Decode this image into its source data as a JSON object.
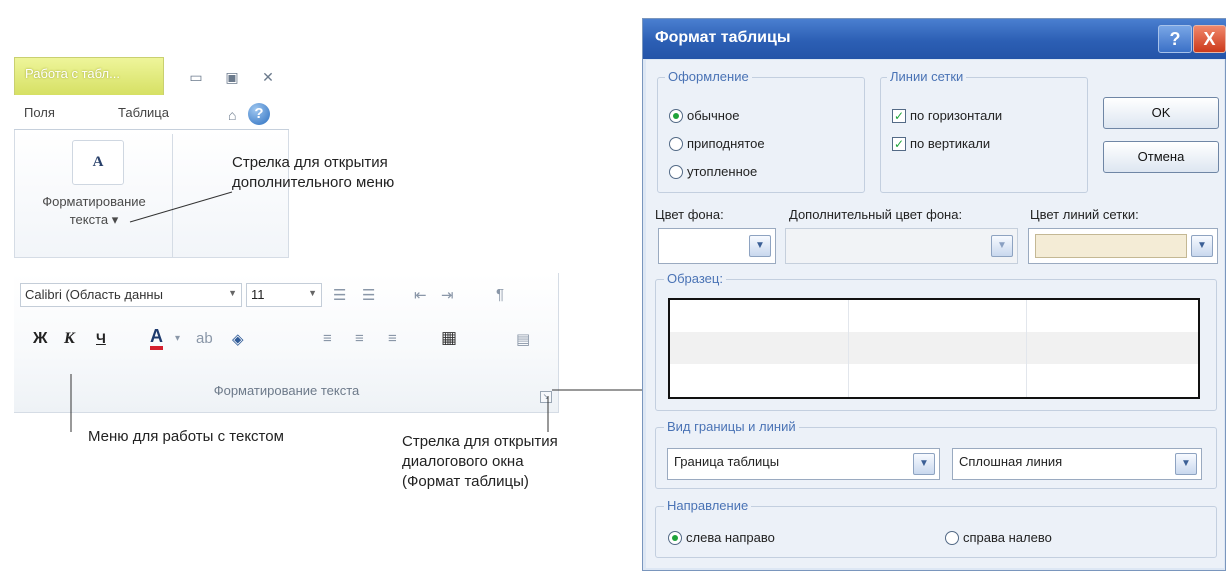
{
  "ribbon": {
    "context_tab": "Работа с табл...",
    "tabs": [
      "Поля",
      "Таблица"
    ],
    "window_buttons": [
      "▭",
      "▣",
      "✕"
    ],
    "help_glyph": "?",
    "big_button_glyph": "A",
    "big_button_label_line1": "Форматирование",
    "big_button_label_line2": "текста ▾"
  },
  "toolbar": {
    "font_name": "Calibri (Область данны",
    "font_size": "11",
    "bold": "Ж",
    "italic": "К",
    "underline": "Ч",
    "font_color_glyph": "A",
    "group_caption": "Форматирование текста"
  },
  "annotations": {
    "arrow_menu_line1": "Стрелка для открытия",
    "arrow_menu_line2": "дополнительного меню",
    "text_menu": "Меню для работы с текстом",
    "dialog_arrow_line1": "Стрелка для открытия",
    "dialog_arrow_line2": "диалогового окна",
    "dialog_arrow_line3": "(Формат таблицы)"
  },
  "dialog": {
    "title": "Формат таблицы",
    "help": "?",
    "close": "X",
    "style_group": {
      "legend": "Оформление",
      "options": [
        "обычное",
        "приподнятое",
        "утопленное"
      ],
      "selected": "обычное"
    },
    "grid_group": {
      "legend": "Линии сетки",
      "horizontal": "по горизонтали",
      "vertical": "по вертикали"
    },
    "ok": "OK",
    "cancel": "Отмена",
    "bg_color_label": "Цвет фона:",
    "alt_bg_color_label": "Дополнительный цвет фона:",
    "grid_color_label": "Цвет линий сетки:",
    "grid_color_value": "#f4ecd6",
    "sample_legend": "Образец:",
    "border_group": {
      "legend": "Вид границы и линий",
      "border_value": "Граница таблицы",
      "line_value": "Сплошная линия"
    },
    "direction_group": {
      "legend": "Направление",
      "ltr": "слева направо",
      "rtl": "справа налево",
      "selected": "слева направо"
    }
  }
}
